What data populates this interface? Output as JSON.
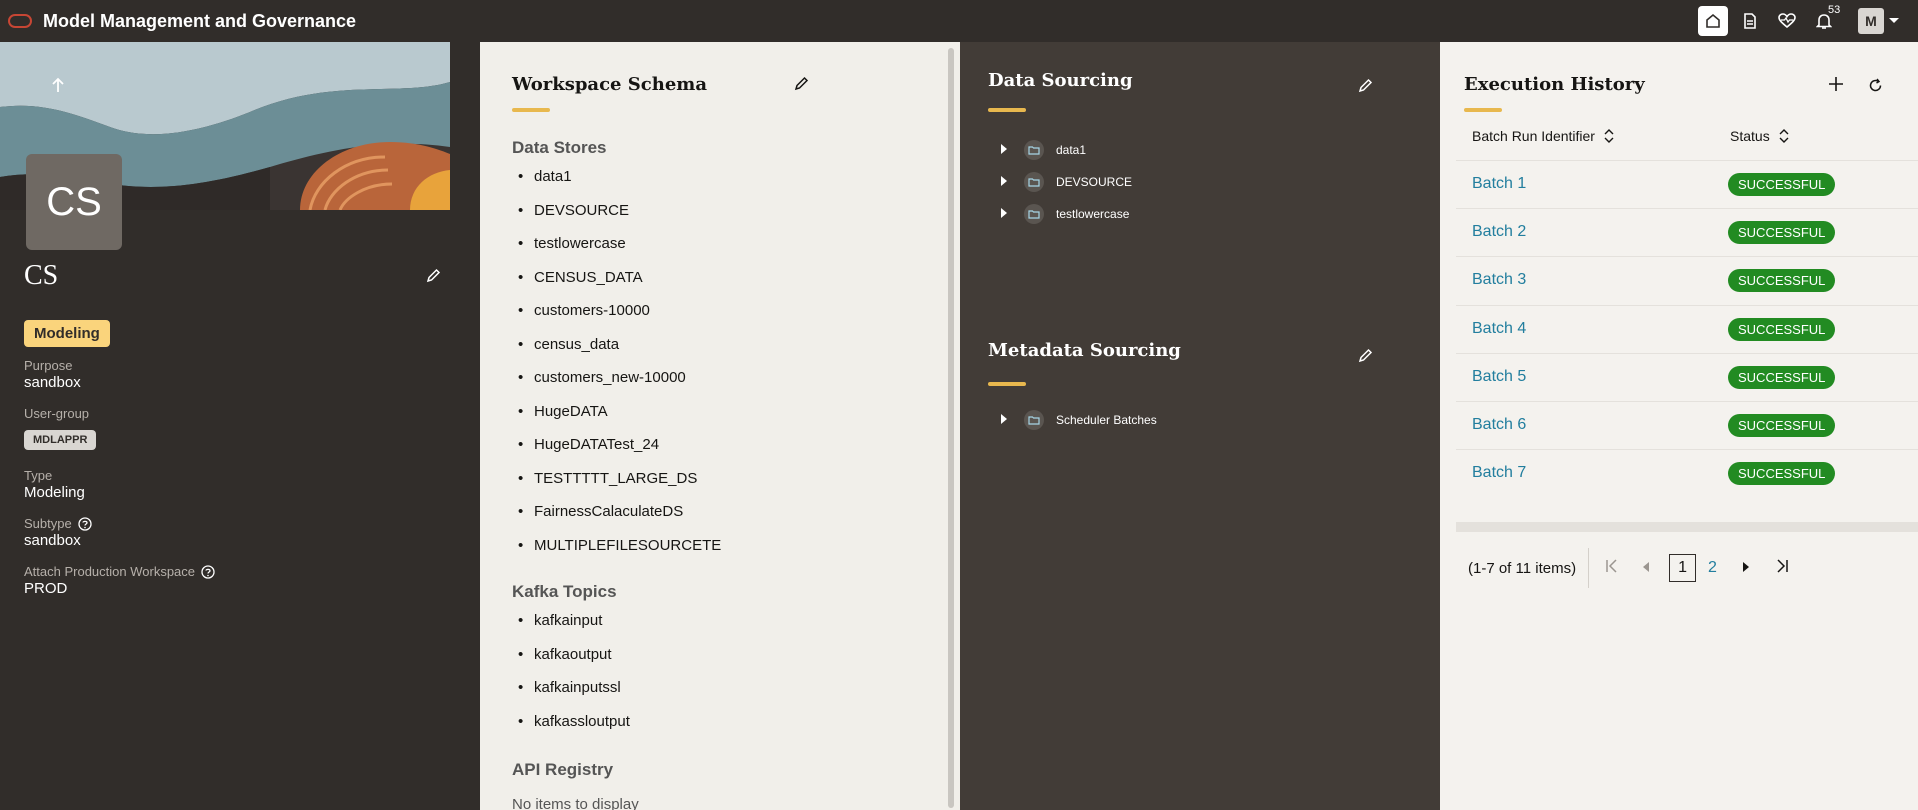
{
  "header": {
    "title": "Model Management and Governance",
    "notification_count": "53",
    "avatar_initial": "M"
  },
  "workspace": {
    "initials": "CS",
    "name": "CS",
    "type_chip": "Modeling",
    "purpose_label": "Purpose",
    "purpose_value": "sandbox",
    "usergroup_label": "User-group",
    "usergroup_value": "MDLAPPR",
    "type_label": "Type",
    "type_value": "Modeling",
    "subtype_label": "Subtype",
    "subtype_value": "sandbox",
    "attach_label": "Attach Production Workspace",
    "attach_value": "PROD"
  },
  "schema": {
    "title": "Workspace Schema",
    "data_stores_label": "Data Stores",
    "data_stores": [
      "data1",
      "DEVSOURCE",
      "testlowercase",
      "CENSUS_DATA",
      "customers-10000",
      "census_data",
      "customers_new-10000",
      "HugeDATA",
      "HugeDATATest_24",
      "TESTTTTT_LARGE_DS",
      "FairnessCalaculateDS",
      "MULTIPLEFILESOURCETE"
    ],
    "kafka_label": "Kafka Topics",
    "kafka_topics": [
      "kafkainput",
      "kafkaoutput",
      "kafkainputssl",
      "kafkassloutput"
    ],
    "api_label": "API Registry",
    "api_empty": "No items to display"
  },
  "data_sourcing": {
    "title": "Data Sourcing",
    "items": [
      "data1",
      "DEVSOURCE",
      "testlowercase"
    ]
  },
  "metadata_sourcing": {
    "title": "Metadata Sourcing",
    "items": [
      "Scheduler Batches"
    ]
  },
  "execution": {
    "title": "Execution History",
    "col_batch": "Batch Run Identifier",
    "col_status": "Status",
    "rows": [
      {
        "batch": "Batch 1",
        "status": "SUCCESSFUL"
      },
      {
        "batch": "Batch 2",
        "status": "SUCCESSFUL"
      },
      {
        "batch": "Batch 3",
        "status": "SUCCESSFUL"
      },
      {
        "batch": "Batch 4",
        "status": "SUCCESSFUL"
      },
      {
        "batch": "Batch 5",
        "status": "SUCCESSFUL"
      },
      {
        "batch": "Batch 6",
        "status": "SUCCESSFUL"
      },
      {
        "batch": "Batch 7",
        "status": "SUCCESSFUL"
      }
    ],
    "pager_summary": "(1-7 of 11 items)",
    "page_current": "1",
    "page_next": "2"
  },
  "colors": {
    "topbar": "#312d2a",
    "accent": "#e8b84e",
    "link": "#227e9e",
    "success": "#228b22",
    "chip": "#fad47c"
  }
}
